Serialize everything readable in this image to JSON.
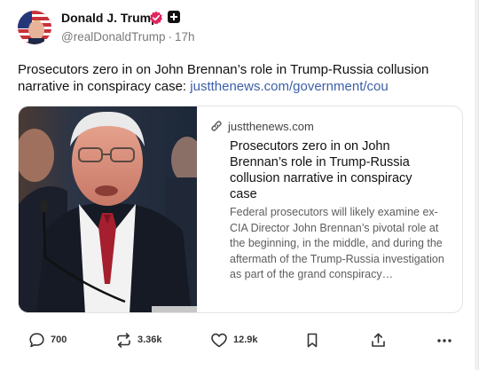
{
  "author": {
    "name": "Donald J. Trump",
    "handle": "@realDonaldTrump",
    "time": "17h"
  },
  "post": {
    "text": "Prosecutors zero in on John Brennan’s role in Trump-Russia collusion narrative in conspiracy case: ",
    "link_text": "justthenews.com/government/cou"
  },
  "card": {
    "domain": "justthenews.com",
    "title": "Prosecutors zero in on John Brennan’s role in Trump-Russia collusion narrative in conspiracy case",
    "description": "Federal prosecutors will likely examine ex-CIA Director John Brennan’s pivotal role at the beginning, in the middle, and during the aftermath of the Trump-Russia investigation as part of the grand conspiracy…"
  },
  "actions": {
    "replies": "700",
    "reposts": "3.36k",
    "likes": "12.9k"
  },
  "icons": {
    "verified": "verified-badge-icon",
    "affiliation": "affiliation-plus-icon",
    "link": "link-icon",
    "reply": "speech-bubble-icon",
    "repost": "repost-arrows-icon",
    "like": "heart-icon",
    "bookmark": "bookmark-icon",
    "share": "share-icon",
    "more": "more-dots-icon"
  },
  "colors": {
    "link": "#3b5fa8",
    "verified": "#e0245e",
    "muted": "#7a7a7a"
  }
}
